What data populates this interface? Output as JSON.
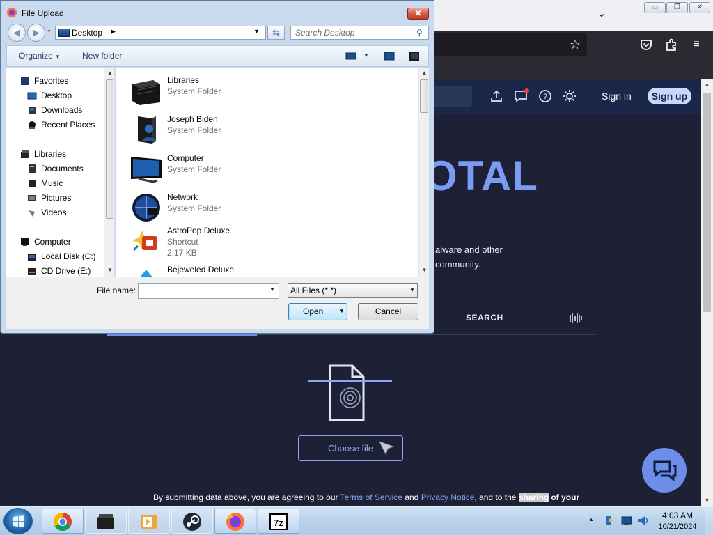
{
  "firefox": {
    "list_all_tabs_icon": "chevron-down-icon",
    "caption_buttons": [
      "minimize",
      "restore",
      "close"
    ],
    "toolbar_icons": [
      "bookmark-star-icon",
      "pocket-icon",
      "extensions-icon",
      "menu-icon"
    ]
  },
  "page": {
    "header": {
      "icons": [
        "upload-icon",
        "chat-icon",
        "help-icon",
        "theme-icon"
      ],
      "sign_in": "Sign in",
      "sign_up": "Sign up"
    },
    "logo_text": "OTAL",
    "description_line1": "alware and other",
    "description_line2": "community.",
    "tab_search": "SEARCH",
    "choose_file": "Choose file",
    "terms": {
      "prefix": "By submitting data above, you are agreeing to our ",
      "terms_link": "Terms of Service",
      "and": " and ",
      "privacy_link": "Privacy Notice",
      "middle": ", and to the ",
      "highlight": "sharing",
      "suffix": " of your"
    },
    "accent_color": "#7a9cf5"
  },
  "dialog": {
    "title": "File Upload",
    "close_label": "✕",
    "address": "Desktop",
    "search_placeholder": "Search Desktop",
    "toolbar": {
      "organize": "Organize",
      "new_folder": "New folder"
    },
    "nav": {
      "favorites": "Favorites",
      "desktop": "Desktop",
      "downloads": "Downloads",
      "recent_places": "Recent Places",
      "libraries": "Libraries",
      "documents": "Documents",
      "music": "Music",
      "pictures": "Pictures",
      "videos": "Videos",
      "computer": "Computer",
      "local_disk": "Local Disk (C:)",
      "cd_drive": "CD Drive (E:)"
    },
    "files": [
      {
        "name": "Libraries",
        "type": "System Folder",
        "size": ""
      },
      {
        "name": "Joseph Biden",
        "type": "System Folder",
        "size": ""
      },
      {
        "name": "Computer",
        "type": "System Folder",
        "size": ""
      },
      {
        "name": "Network",
        "type": "System Folder",
        "size": ""
      },
      {
        "name": "AstroPop Deluxe",
        "type": "Shortcut",
        "size": "2.17 KB"
      },
      {
        "name": "Bejeweled Deluxe",
        "type": "",
        "size": ""
      }
    ],
    "file_name_label": "File name:",
    "file_name_value": "",
    "file_type": "All Files (*.*)",
    "open_button": "Open",
    "cancel_button": "Cancel"
  },
  "taskbar": {
    "apps": [
      "chrome-icon",
      "libraries-icon",
      "media-player-icon",
      "steam-icon",
      "firefox-icon",
      "7zip-icon"
    ],
    "time": "4:03 AM",
    "date": "10/21/2024"
  }
}
